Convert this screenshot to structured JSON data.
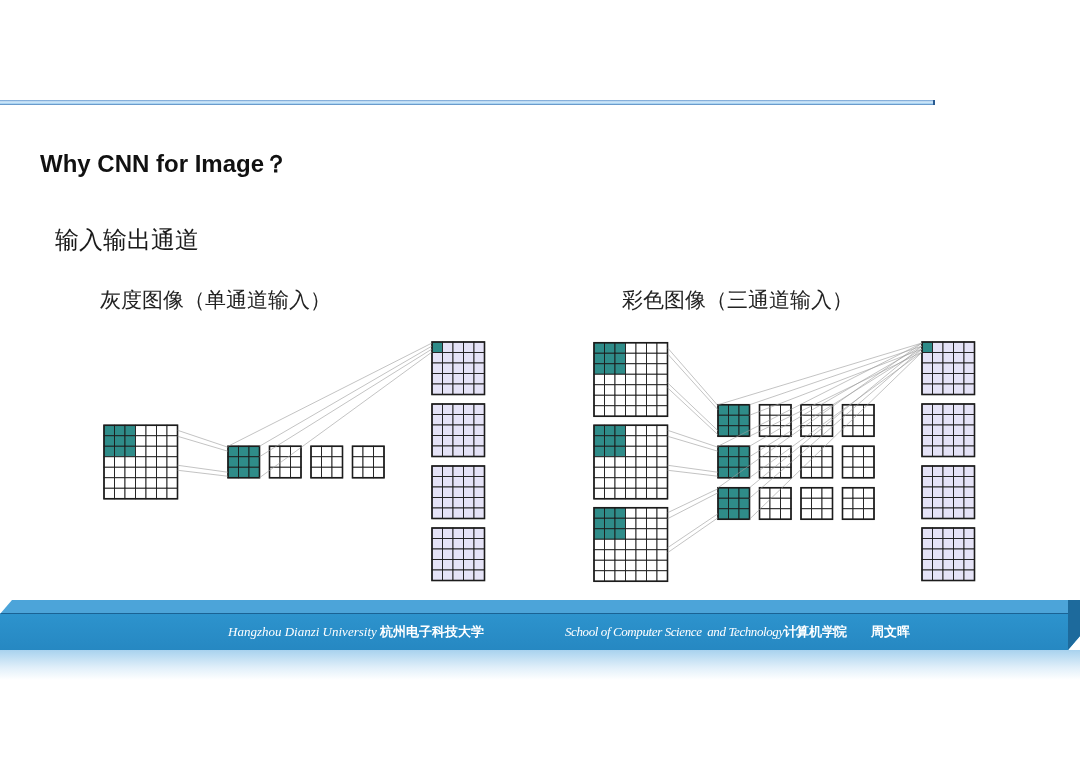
{
  "header": {
    "title": "Why CNN for Image？"
  },
  "subtitle": "输入输出通道",
  "diagrams": [
    {
      "caption": "灰度图像（单通道输入）",
      "inputs": [
        {
          "highlighted": true
        }
      ],
      "filters": [
        [
          {
            "highlighted": true
          },
          {
            "highlighted": false
          },
          {
            "highlighted": false
          },
          {
            "highlighted": false
          }
        ]
      ],
      "outputs": [
        {
          "highlighted": true
        },
        {
          "highlighted": false
        },
        {
          "highlighted": false
        },
        {
          "highlighted": false
        }
      ]
    },
    {
      "caption": "彩色图像（三通道输入）",
      "inputs": [
        {
          "highlighted": true
        },
        {
          "highlighted": true
        },
        {
          "highlighted": true
        }
      ],
      "filters": [
        [
          {
            "highlighted": true
          },
          {
            "highlighted": false
          },
          {
            "highlighted": false
          },
          {
            "highlighted": false
          }
        ],
        [
          {
            "highlighted": true
          },
          {
            "highlighted": false
          },
          {
            "highlighted": false
          },
          {
            "highlighted": false
          }
        ],
        [
          {
            "highlighted": true
          },
          {
            "highlighted": false
          },
          {
            "highlighted": false
          },
          {
            "highlighted": false
          }
        ]
      ],
      "outputs": [
        {
          "highlighted": true
        },
        {
          "highlighted": false
        },
        {
          "highlighted": false
        },
        {
          "highlighted": false
        }
      ]
    }
  ],
  "footer": {
    "university": "Hangzhou Dianzi University **杭州电子科技大学**",
    "school": "School of Computer Science  and Technology**计算机学院**",
    "author": "周文晖"
  }
}
